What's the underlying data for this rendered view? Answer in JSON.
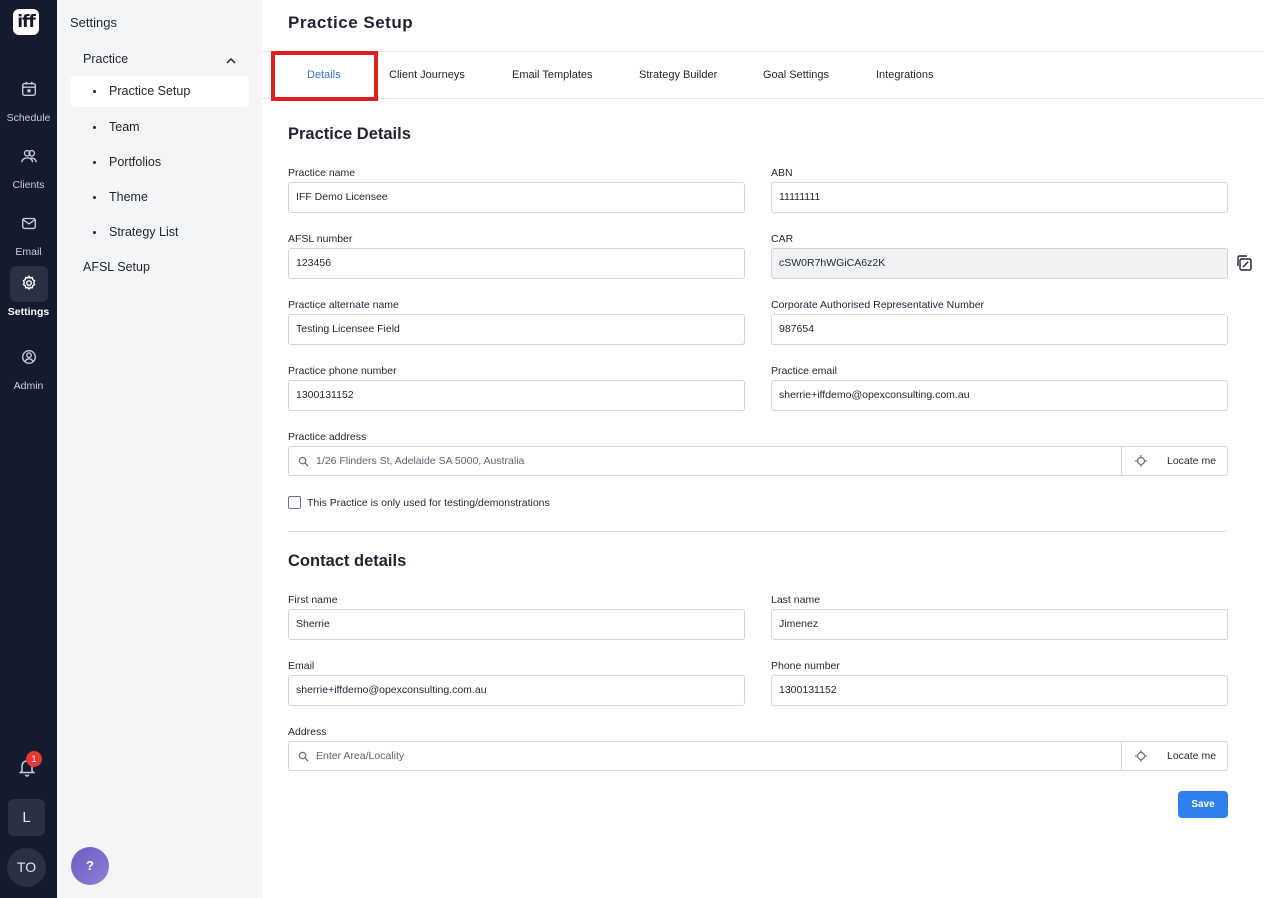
{
  "rail": {
    "logo": "iff",
    "items": [
      {
        "label": "Schedule",
        "icon": "calendar-icon"
      },
      {
        "label": "Clients",
        "icon": "users-icon"
      },
      {
        "label": "Email",
        "icon": "mail-icon"
      },
      {
        "label": "Settings",
        "icon": "gear-icon"
      },
      {
        "label": "Admin",
        "icon": "user-circle-icon"
      }
    ],
    "notification_count": "1",
    "workspace_initial": "L",
    "user_initials": "TO"
  },
  "sidebar": {
    "title": "Settings",
    "group": "Practice",
    "items": [
      "Practice Setup",
      "Team",
      "Portfolios",
      "Theme",
      "Strategy List"
    ],
    "afsl": "AFSL Setup",
    "help": "?"
  },
  "page": {
    "title": "Practice Setup",
    "tabs": [
      "Details",
      "Client Journeys",
      "Email Templates",
      "Strategy Builder",
      "Goal Settings",
      "Integrations"
    ]
  },
  "practice": {
    "title": "Practice Details",
    "name_label": "Practice name",
    "name": "IFF Demo Licensee",
    "abn_label": "ABN",
    "abn": "11111111",
    "afsl_label": "AFSL number",
    "afsl": "123456",
    "car_label": "CAR",
    "car": "cSW0R7hWGiCA6z2K",
    "alt_label": "Practice alternate name",
    "alt": "Testing Licensee Field",
    "carn_label": "Corporate Authorised Representative Number",
    "carn": "987654",
    "phone_label": "Practice phone number",
    "phone": "1300131152",
    "email_label": "Practice email",
    "email": "sherrie+iffdemo@opexconsulting.com.au",
    "address_label": "Practice address",
    "address": "1/26 Flinders St, Adelaide SA 5000, Australia",
    "locate": "Locate me",
    "testing_label": "This Practice is only used for testing/demonstrations"
  },
  "contact": {
    "title": "Contact details",
    "first_label": "First name",
    "first": "Sherrie",
    "last_label": "Last name",
    "last": "Jimenez",
    "email_label": "Email",
    "email": "sherrie+iffdemo@opexconsulting.com.au",
    "phone_label": "Phone number",
    "phone": "1300131152",
    "address_label": "Address",
    "address_placeholder": "Enter Area/Locality",
    "locate": "Locate me"
  },
  "actions": {
    "save": "Save"
  },
  "colors": {
    "rail_bg": "#141b2d",
    "accent": "#2f80ed",
    "active_tab": "#3b6fd4",
    "highlight": "#e0201c"
  }
}
